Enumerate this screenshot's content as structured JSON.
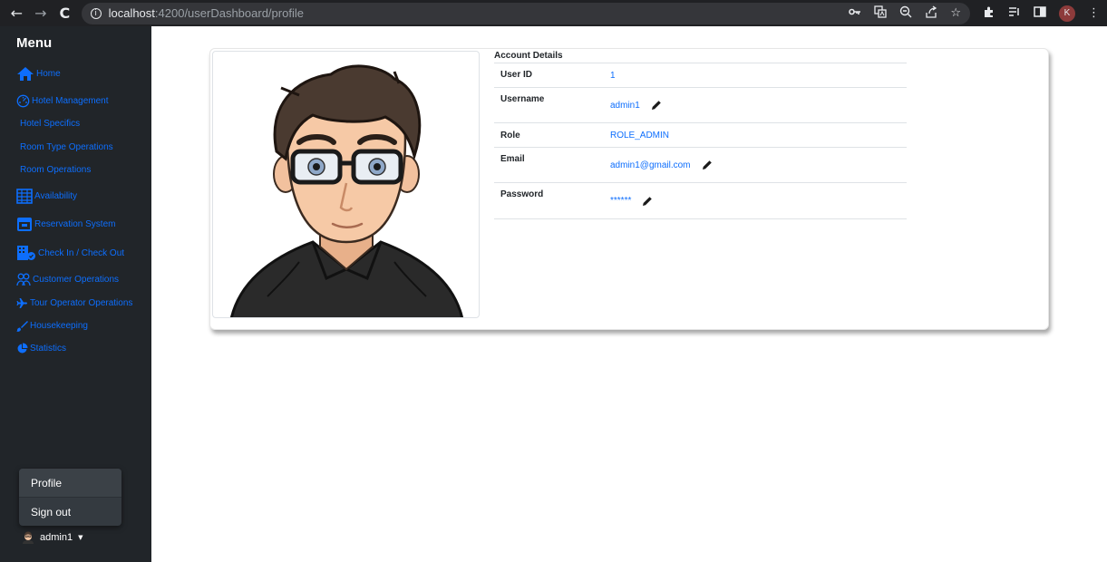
{
  "browser": {
    "url_host": "localhost",
    "url_rest": ":4200/userDashboard/profile",
    "profile_initial": "K"
  },
  "sidebar": {
    "title": "Menu",
    "items": [
      {
        "label": "Home",
        "icon": "home-icon"
      },
      {
        "label": "Hotel Management",
        "icon": "dashboard-icon"
      },
      {
        "label": "Hotel Specifics",
        "icon": ""
      },
      {
        "label": "Room Type Operations",
        "icon": ""
      },
      {
        "label": "Room Operations",
        "icon": ""
      },
      {
        "label": "Availability",
        "icon": "table-icon"
      },
      {
        "label": "Reservation System",
        "icon": "calendar-icon"
      },
      {
        "label": "Check In / Check Out",
        "icon": "building-check-icon"
      },
      {
        "label": "Customer Operations",
        "icon": "people-icon"
      },
      {
        "label": "Tour Operator Operations",
        "icon": "airplane-icon"
      },
      {
        "label": "Housekeeping",
        "icon": "brush-icon"
      },
      {
        "label": "Statistics",
        "icon": "pie-chart-icon"
      }
    ],
    "dropdown": {
      "profile": "Profile",
      "signout": "Sign out"
    },
    "username": "admin1"
  },
  "account": {
    "title": "Account Details",
    "rows": [
      {
        "label": "User ID",
        "value": "1"
      },
      {
        "label": "Username",
        "value": "admin1"
      },
      {
        "label": "Role",
        "value": "ROLE_ADMIN"
      },
      {
        "label": "Email",
        "value": "admin1@gmail.com"
      },
      {
        "label": "Password",
        "value": "******"
      }
    ]
  },
  "colors": {
    "sidebar_bg": "#212529",
    "link": "#0d6efd",
    "browser_bg": "#202124"
  }
}
